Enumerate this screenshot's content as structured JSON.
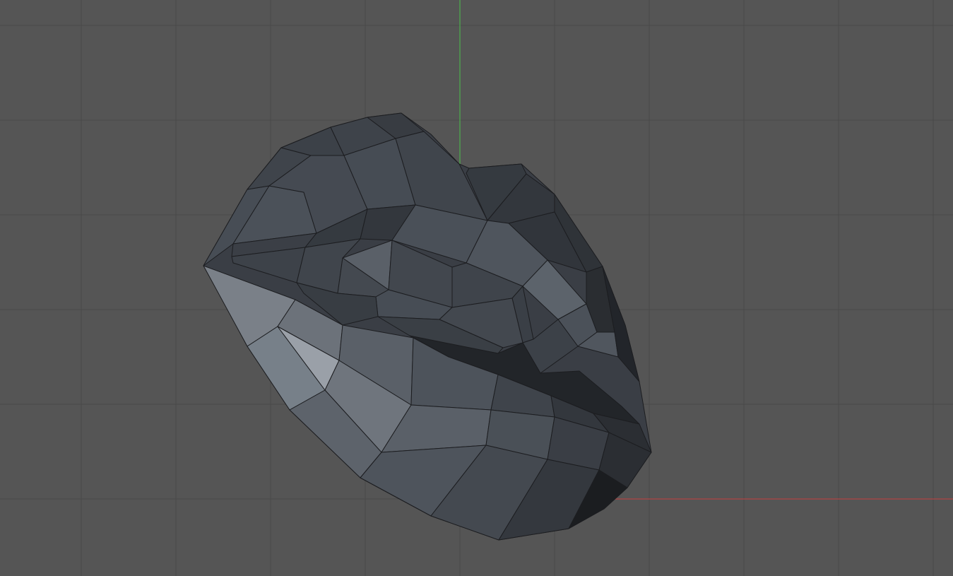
{
  "viewport": {
    "view": "3d-viewport",
    "background_color": "#555555",
    "grid_color": "#494949",
    "axis_y_color": "#4cae4c",
    "axis_x_color": "#b04545",
    "mesh_wire_color": "#1c1d20",
    "object": "lips-mesh"
  }
}
